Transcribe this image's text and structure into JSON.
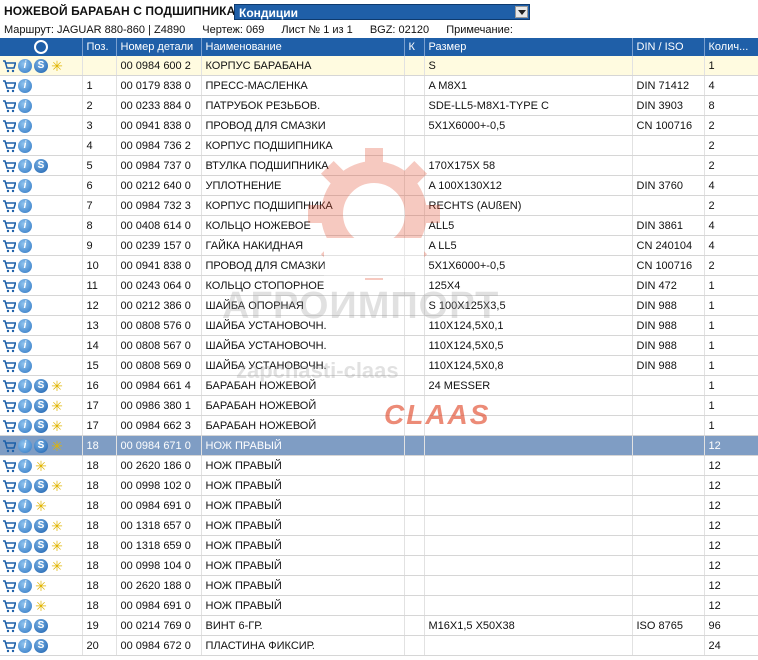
{
  "header": {
    "title": "НОЖЕВОЙ БАРАБАН С ПОДШИПНИКАМИ",
    "dropdown_value": "Кондиции"
  },
  "info": {
    "route": "Маршрут: JAGUAR 880-860 | Z4890",
    "drawing": "Чертеж: 069",
    "sheet": "Лист № 1 из 1",
    "bgz": "BGZ: 02120",
    "note": "Примечание:"
  },
  "columns": [
    "Поз.",
    "Номер детали",
    "Наименование",
    "К",
    "Размер",
    "DIN / ISO",
    "Колич..."
  ],
  "rows": [
    {
      "icons": [
        "cart",
        "i",
        "s",
        "star"
      ],
      "pos": "",
      "part": "00 0984 600 2",
      "name": "КОРПУС БАРАБАНА",
      "k": "",
      "size": "S",
      "din": "",
      "qty": "1"
    },
    {
      "icons": [
        "cart",
        "i"
      ],
      "pos": "1",
      "part": "00 0179 838 0",
      "name": "ПРЕСС-МАСЛЕНКА",
      "k": "",
      "size": "A M8X1",
      "din": "DIN 71412",
      "qty": "4"
    },
    {
      "icons": [
        "cart",
        "i"
      ],
      "pos": "2",
      "part": "00 0233 884 0",
      "name": "ПАТРУБОК РЕЗЬБОВ.",
      "k": "",
      "size": "SDE-LL5-M8X1-TYPE C",
      "din": "DIN 3903",
      "qty": "8"
    },
    {
      "icons": [
        "cart",
        "i"
      ],
      "pos": "3",
      "part": "00 0941 838 0",
      "name": "ПРОВОД ДЛЯ СМАЗКИ",
      "k": "",
      "size": "5X1X6000+-0,5",
      "din": "CN 100716",
      "qty": "2"
    },
    {
      "icons": [
        "cart",
        "i"
      ],
      "pos": "4",
      "part": "00 0984 736 2",
      "name": "КОРПУС ПОДШИПНИКА",
      "k": "",
      "size": "",
      "din": "",
      "qty": "2"
    },
    {
      "icons": [
        "cart",
        "i",
        "s"
      ],
      "pos": "5",
      "part": "00 0984 737 0",
      "name": "ВТУЛКА ПОДШИПНИКА",
      "k": "",
      "size": "170X175X 58",
      "din": "",
      "qty": "2"
    },
    {
      "icons": [
        "cart",
        "i"
      ],
      "pos": "6",
      "part": "00 0212 640 0",
      "name": "УПЛОТНЕНИЕ",
      "k": "",
      "size": "A 100X130X12",
      "din": "DIN 3760",
      "qty": "4"
    },
    {
      "icons": [
        "cart",
        "i"
      ],
      "pos": "7",
      "part": "00 0984 732 3",
      "name": "КОРПУС ПОДШИПНИКА",
      "k": "",
      "size": "RECHTS (AUßEN)",
      "din": "",
      "qty": "2"
    },
    {
      "icons": [
        "cart",
        "i"
      ],
      "pos": "8",
      "part": "00 0408 614 0",
      "name": "КОЛЬЦО НОЖЕВОЕ",
      "k": "",
      "size": "ALL5",
      "din": "DIN 3861",
      "qty": "4"
    },
    {
      "icons": [
        "cart",
        "i"
      ],
      "pos": "9",
      "part": "00 0239 157 0",
      "name": "ГАЙКА НАКИДНАЯ",
      "k": "",
      "size": "A LL5",
      "din": "CN 240104",
      "qty": "4"
    },
    {
      "icons": [
        "cart",
        "i"
      ],
      "pos": "10",
      "part": "00 0941 838 0",
      "name": "ПРОВОД ДЛЯ СМАЗКИ",
      "k": "",
      "size": "5X1X6000+-0,5",
      "din": "CN 100716",
      "qty": "2"
    },
    {
      "icons": [
        "cart",
        "i"
      ],
      "pos": "11",
      "part": "00 0243 064 0",
      "name": "КОЛЬЦО СТОПОРНОЕ",
      "k": "",
      "size": "125X4",
      "din": "DIN 472",
      "qty": "1"
    },
    {
      "icons": [
        "cart",
        "i"
      ],
      "pos": "12",
      "part": "00 0212 386 0",
      "name": "ШАЙБА ОПОРНАЯ",
      "k": "",
      "size": "S 100X125X3,5",
      "din": "DIN 988",
      "qty": "1"
    },
    {
      "icons": [
        "cart",
        "i"
      ],
      "pos": "13",
      "part": "00 0808 576 0",
      "name": "ШАЙБА УСТАНОВОЧН.",
      "k": "",
      "size": "110X124,5X0,1",
      "din": "DIN 988",
      "qty": "1"
    },
    {
      "icons": [
        "cart",
        "i"
      ],
      "pos": "14",
      "part": "00 0808 567 0",
      "name": "ШАЙБА УСТАНОВОЧН.",
      "k": "",
      "size": "110X124,5X0,5",
      "din": "DIN 988",
      "qty": "1"
    },
    {
      "icons": [
        "cart",
        "i"
      ],
      "pos": "15",
      "part": "00 0808 569 0",
      "name": "ШАЙБА УСТАНОВОЧН.",
      "k": "",
      "size": "110X124,5X0,8",
      "din": "DIN 988",
      "qty": "1"
    },
    {
      "icons": [
        "cart",
        "i",
        "s",
        "star"
      ],
      "pos": "16",
      "part": "00 0984 661 4",
      "name": "БАРАБАН НОЖЕВОЙ",
      "k": "",
      "size": "24 MESSER",
      "din": "",
      "qty": "1"
    },
    {
      "icons": [
        "cart",
        "i",
        "s",
        "star"
      ],
      "pos": "17",
      "part": "00 0986 380 1",
      "name": "БАРАБАН НОЖЕВОЙ",
      "k": "",
      "size": "",
      "din": "",
      "qty": "1"
    },
    {
      "icons": [
        "cart",
        "i",
        "s",
        "star"
      ],
      "pos": "17",
      "part": "00 0984 662 3",
      "name": "БАРАБАН НОЖЕВОЙ",
      "k": "",
      "size": "",
      "din": "",
      "qty": "1"
    },
    {
      "icons": [
        "cart",
        "i",
        "s",
        "star"
      ],
      "pos": "18",
      "part": "00 0984 671 0",
      "name": "НОЖ ПРАВЫЙ",
      "k": "",
      "size": "",
      "din": "",
      "qty": "12",
      "selected": true
    },
    {
      "icons": [
        "cart",
        "i",
        "star"
      ],
      "pos": "18",
      "part": "00 2620 186 0",
      "name": "НОЖ ПРАВЫЙ",
      "k": "",
      "size": "",
      "din": "",
      "qty": "12"
    },
    {
      "icons": [
        "cart",
        "i",
        "s",
        "star"
      ],
      "pos": "18",
      "part": "00 0998 102 0",
      "name": "НОЖ ПРАВЫЙ",
      "k": "",
      "size": "",
      "din": "",
      "qty": "12"
    },
    {
      "icons": [
        "cart",
        "i",
        "star"
      ],
      "pos": "18",
      "part": "00 0984 691 0",
      "name": "НОЖ ПРАВЫЙ",
      "k": "",
      "size": "",
      "din": "",
      "qty": "12"
    },
    {
      "icons": [
        "cart",
        "i",
        "s",
        "star"
      ],
      "pos": "18",
      "part": "00 1318 657 0",
      "name": "НОЖ ПРАВЫЙ",
      "k": "",
      "size": "",
      "din": "",
      "qty": "12"
    },
    {
      "icons": [
        "cart",
        "i",
        "s",
        "star"
      ],
      "pos": "18",
      "part": "00 1318 659 0",
      "name": "НОЖ ПРАВЫЙ",
      "k": "",
      "size": "",
      "din": "",
      "qty": "12"
    },
    {
      "icons": [
        "cart",
        "i",
        "s",
        "star"
      ],
      "pos": "18",
      "part": "00 0998 104 0",
      "name": "НОЖ ПРАВЫЙ",
      "k": "",
      "size": "",
      "din": "",
      "qty": "12"
    },
    {
      "icons": [
        "cart",
        "i",
        "star"
      ],
      "pos": "18",
      "part": "00 2620 188 0",
      "name": "НОЖ ПРАВЫЙ",
      "k": "",
      "size": "",
      "din": "",
      "qty": "12"
    },
    {
      "icons": [
        "cart",
        "i",
        "star"
      ],
      "pos": "18",
      "part": "00 0984 691 0",
      "name": "НОЖ ПРАВЫЙ",
      "k": "",
      "size": "",
      "din": "",
      "qty": "12"
    },
    {
      "icons": [
        "cart",
        "i",
        "s"
      ],
      "pos": "19",
      "part": "00 0214 769 0",
      "name": "ВИНТ 6-ГР.",
      "k": "",
      "size": "M16X1,5 X50X38",
      "din": "ISO 8765",
      "qty": "96"
    },
    {
      "icons": [
        "cart",
        "i",
        "s"
      ],
      "pos": "20",
      "part": "00 0984 672 0",
      "name": "ПЛАСТИНА ФИКСИР.",
      "k": "",
      "size": "",
      "din": "",
      "qty": "24"
    }
  ],
  "watermark": {
    "line1": "АГРОИМПОРТ",
    "line2": "zapchasti-claas",
    "brand": "CLAAS"
  },
  "colors": {
    "header_bg": "#1f5fa8",
    "selected_row": "#7f9dc4",
    "first_row": "#fffbe0",
    "watermark_red": "#e24a2b"
  }
}
